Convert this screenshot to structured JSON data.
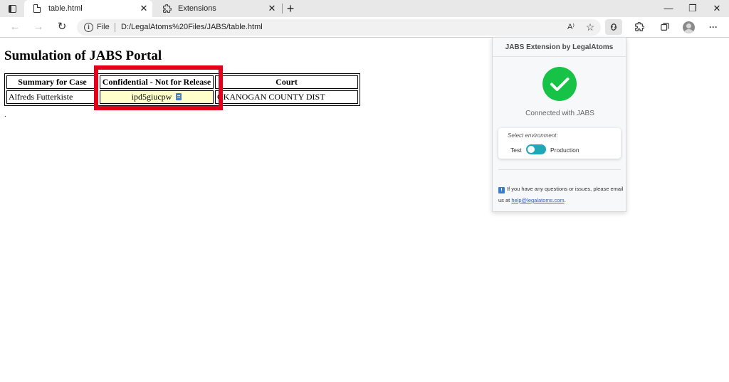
{
  "browser": {
    "tabs": [
      {
        "label": "table.html",
        "active": true,
        "icon": "document-icon"
      },
      {
        "label": "Extensions",
        "active": false,
        "icon": "puzzle-icon"
      }
    ],
    "close_glyph": "✕",
    "new_tab_glyph": "+",
    "window_controls": {
      "minimize": "—",
      "restore": "❐",
      "close": "✕"
    },
    "address": {
      "protocol_label": "File",
      "url": "D:/LegalAtoms%20Files/JABS/table.html"
    },
    "nav": {
      "back": "←",
      "forward": "→",
      "reload": "↻"
    },
    "toolbar_icons": {
      "read_aloud": "A⁾",
      "favorite": "☆",
      "extension_jabs": "⊘",
      "extensions": "⧉",
      "collections": "⧉",
      "more": "···"
    }
  },
  "page": {
    "title": "Sumulation of JABS Portal",
    "table": {
      "headers": [
        "Summary for Case",
        "Confidential - Not for Release",
        "Court"
      ],
      "rows": [
        [
          "Alfreds Futterkiste",
          "ipd5giucpw",
          "OKANOGAN COUNTY DIST"
        ]
      ]
    },
    "trailing_dot": "."
  },
  "popup": {
    "header": "JABS Extension by LegalAtoms",
    "status": "Connected with JABS",
    "env_label": "Select environment:",
    "env_test": "Test",
    "env_production": "Production",
    "env_selected": "Production",
    "help_prefix": "If you have any questions or issues, please email us at",
    "help_email": "help@legalatoms.com",
    "help_suffix": ".",
    "colors": {
      "success": "#17c346",
      "toggle": "#20a8b8",
      "link": "#2a5bd7"
    }
  },
  "annotation": {
    "highlight_color": "#e3001b"
  }
}
